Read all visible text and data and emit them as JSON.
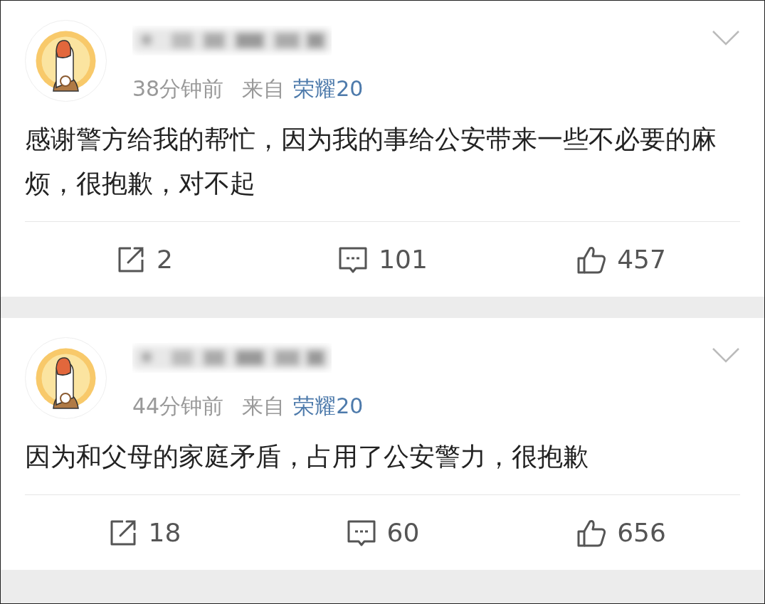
{
  "posts": [
    {
      "time": "38分钟前",
      "source_label": "来自",
      "source": "荣耀20",
      "text": "感谢警方给我的帮忙，因为我的事给公安带来一些不必要的麻烦，很抱歉，对不起",
      "reposts": "2",
      "comments": "101",
      "likes": "457"
    },
    {
      "time": "44分钟前",
      "source_label": "来自",
      "source": "荣耀20",
      "text": "因为和父母的家庭矛盾，占用了公安警力，很抱歉",
      "reposts": "18",
      "comments": "60",
      "likes": "656"
    }
  ]
}
